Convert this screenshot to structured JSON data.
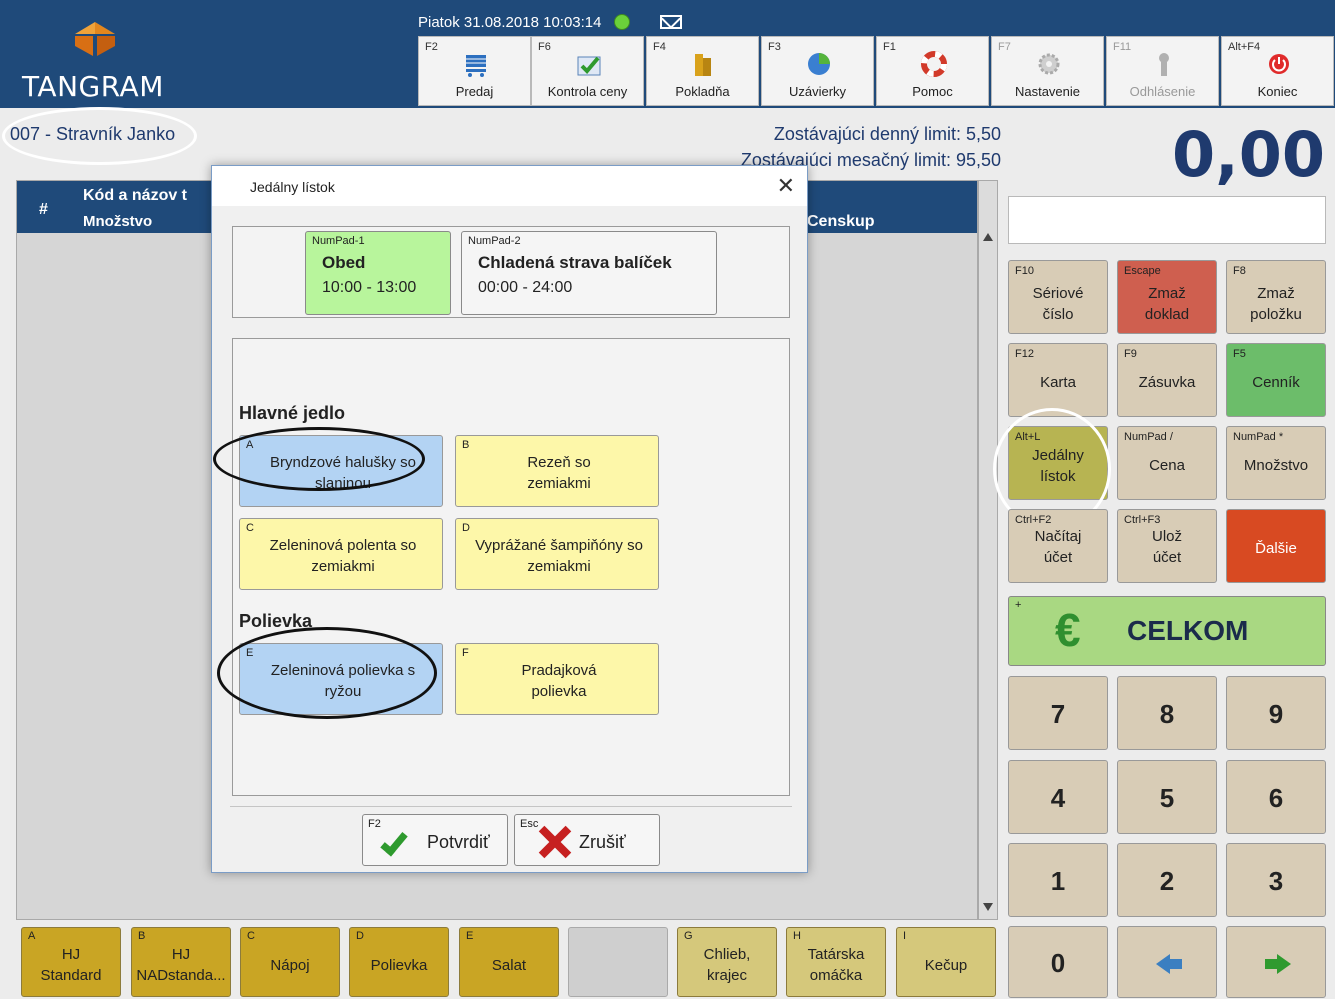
{
  "app": {
    "name": "TANGRAM",
    "status_datetime": "Piatok 31.08.2018 10:03:14"
  },
  "toptabs": [
    {
      "key": "F2",
      "label": "Predaj",
      "icon": "cart-icon"
    },
    {
      "key": "F6",
      "label": "Kontrola ceny",
      "icon": "price-check-icon"
    },
    {
      "key": "F4",
      "label": "Pokladňa",
      "icon": "cash-desk-icon"
    },
    {
      "key": "F3",
      "label": "Uzávierky",
      "icon": "closing-icon"
    },
    {
      "key": "F1",
      "label": "Pomoc",
      "icon": "lifebuoy-icon"
    },
    {
      "key": "F7",
      "label": "Nastavenie",
      "icon": "gear-icon"
    },
    {
      "key": "F11",
      "label": "Odhlásenie",
      "icon": "logout-icon"
    },
    {
      "key": "Alt+F4",
      "label": "Koniec",
      "icon": "power-icon"
    }
  ],
  "customer": "007 - Stravník Janko",
  "limits": {
    "daily": "Zostávajúci denný limit: 5,50",
    "monthly": "Zostávajúci mesačný limit: 95,50"
  },
  "total": "0,00",
  "receipt": {
    "col_num": "#",
    "col_name": "Kód a názov t",
    "col_qty": "Množstvo",
    "col_price": "Censkup"
  },
  "fkeys": [
    {
      "key": "F10",
      "label1": "Sériové",
      "label2": "číslo"
    },
    {
      "key": "Escape",
      "label1": "Zmaž",
      "label2": "doklad"
    },
    {
      "key": "F8",
      "label1": "Zmaž",
      "label2": "položku"
    },
    {
      "key": "F12",
      "label1": "Karta",
      "label2": ""
    },
    {
      "key": "F9",
      "label1": "Zásuvka",
      "label2": ""
    },
    {
      "key": "F5",
      "label1": "Cenník",
      "label2": ""
    },
    {
      "key": "Alt+L",
      "label1": "Jedálny",
      "label2": "lístok"
    },
    {
      "key": "NumPad /",
      "label1": "Cena",
      "label2": ""
    },
    {
      "key": "NumPad *",
      "label1": "Množstvo",
      "label2": ""
    },
    {
      "key": "Ctrl+F2",
      "label1": "Načítaj",
      "label2": "účet"
    },
    {
      "key": "Ctrl+F3",
      "label1": "Ulož",
      "label2": "účet"
    },
    {
      "key": "",
      "label1": "Ďalšie",
      "label2": ""
    }
  ],
  "celkom": {
    "key": "+",
    "currency": "€",
    "label": "CELKOM"
  },
  "numpad": [
    "7",
    "8",
    "9",
    "4",
    "5",
    "6",
    "1",
    "2",
    "3",
    "0"
  ],
  "categories": [
    {
      "key": "A",
      "label1": "HJ",
      "label2": "Standard"
    },
    {
      "key": "B",
      "label1": "HJ",
      "label2": "NADstanda..."
    },
    {
      "key": "C",
      "label1": "Nápoj",
      "label2": ""
    },
    {
      "key": "D",
      "label1": "Polievka",
      "label2": ""
    },
    {
      "key": "E",
      "label1": "Salat",
      "label2": ""
    },
    {
      "key": "",
      "label1": "",
      "label2": ""
    },
    {
      "key": "G",
      "label1": "Chlieb,",
      "label2": "krajec"
    },
    {
      "key": "H",
      "label1": "Tatárska",
      "label2": "omáčka"
    },
    {
      "key": "I",
      "label1": "Kečup",
      "label2": ""
    }
  ],
  "dialog": {
    "title": "Jedálny lístok",
    "close": "✕",
    "meal_types": [
      {
        "key": "NumPad-1",
        "name": "Obed",
        "time": "10:00 - 13:00"
      },
      {
        "key": "NumPad-2",
        "name": "Chladená strava balíček",
        "time": "00:00 - 24:00"
      }
    ],
    "section_main": "Hlavné jedlo",
    "section_soup": "Polievka",
    "dishes": [
      {
        "key": "A",
        "line1": "Bryndzové halušky so",
        "line2": "slaninou"
      },
      {
        "key": "B",
        "line1": "Rezeň so",
        "line2": "zemiakmi"
      },
      {
        "key": "C",
        "line1": "Zeleninová polenta so",
        "line2": "zemiakmi"
      },
      {
        "key": "D",
        "line1": "Vyprážané šampiňóny so",
        "line2": "zemiakmi"
      },
      {
        "key": "E",
        "line1": "Zeleninová polievka s",
        "line2": "ryžou"
      },
      {
        "key": "F",
        "line1": "Pradajková",
        "line2": "polievka"
      }
    ],
    "confirm": {
      "key": "F2",
      "label": "Potvrdiť"
    },
    "cancel": {
      "key": "Esc",
      "label": "Zrušiť"
    }
  },
  "colors": {
    "header_blue": "#1f4a7a",
    "selected_blue": "#b3d3f3",
    "dish_yellow": "#fdf7a9",
    "active_green": "#b8f59c"
  }
}
